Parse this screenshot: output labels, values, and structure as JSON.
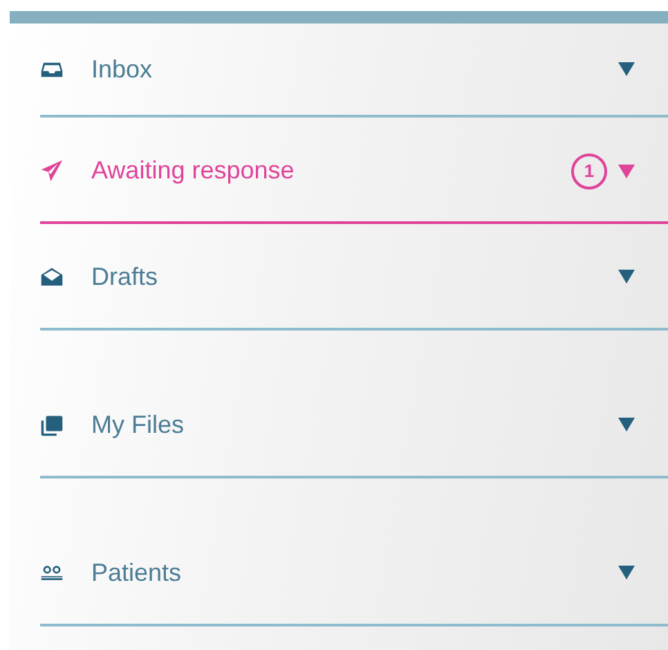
{
  "nav": {
    "items": [
      {
        "label": "Inbox",
        "selected": false
      },
      {
        "label": "Awaiting response",
        "selected": true,
        "count": "1"
      },
      {
        "label": "Drafts",
        "selected": false
      },
      {
        "label": "My Files",
        "selected": false
      },
      {
        "label": "Patients",
        "selected": false
      }
    ]
  }
}
